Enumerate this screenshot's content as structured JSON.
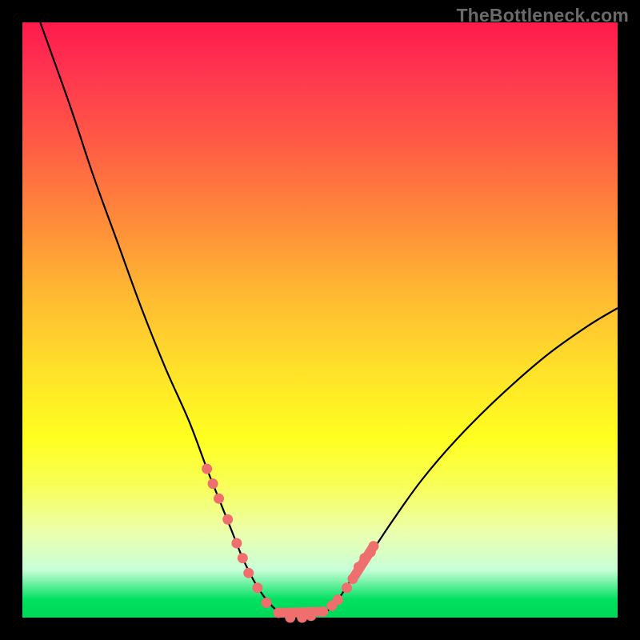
{
  "watermark": "TheBottleneck.com",
  "colors": {
    "frame": "#000000",
    "curve": "#000000",
    "marker": "#ef6f6f",
    "gradient_top": "#ff1a4d",
    "gradient_bottom": "#00d858"
  },
  "chart_data": {
    "type": "line",
    "title": "",
    "xlabel": "",
    "ylabel": "",
    "xlim": [
      0,
      100
    ],
    "ylim": [
      0,
      100
    ],
    "series": [
      {
        "name": "bottleneck-curve",
        "x": [
          3,
          8,
          12,
          16,
          20,
          24,
          28,
          31,
          33,
          35,
          37,
          39,
          41,
          43,
          45,
          48,
          51,
          53,
          55,
          58,
          62,
          67,
          73,
          80,
          88,
          95,
          100
        ],
        "y": [
          100,
          86,
          74,
          63,
          52,
          42,
          33,
          25,
          20,
          15,
          10,
          6,
          3,
          1,
          0,
          0,
          1,
          3,
          6,
          10,
          16,
          23,
          30,
          37,
          44,
          49,
          52
        ]
      }
    ],
    "markers": [
      {
        "x": 31.0,
        "y": 25.0
      },
      {
        "x": 32.0,
        "y": 22.5
      },
      {
        "x": 33.0,
        "y": 20.0
      },
      {
        "x": 34.5,
        "y": 16.5
      },
      {
        "x": 36.0,
        "y": 12.5
      },
      {
        "x": 37.0,
        "y": 10.0
      },
      {
        "x": 38.0,
        "y": 7.5
      },
      {
        "x": 39.5,
        "y": 5.0
      },
      {
        "x": 41.0,
        "y": 2.5
      },
      {
        "x": 43.0,
        "y": 0.8
      },
      {
        "x": 45.0,
        "y": 0.0
      },
      {
        "x": 47.0,
        "y": 0.0
      },
      {
        "x": 48.5,
        "y": 0.3
      },
      {
        "x": 50.5,
        "y": 1.0
      },
      {
        "x": 52.0,
        "y": 2.0
      },
      {
        "x": 53.0,
        "y": 3.0
      },
      {
        "x": 54.5,
        "y": 5.0
      },
      {
        "x": 55.5,
        "y": 6.5
      },
      {
        "x": 56.5,
        "y": 8.5
      },
      {
        "x": 57.5,
        "y": 10.0
      },
      {
        "x": 58.5,
        "y": 11.0
      },
      {
        "x": 59.0,
        "y": 12.0
      }
    ],
    "marker_segments": [
      {
        "x1": 43.0,
        "y1": 0.8,
        "x2": 50.5,
        "y2": 1.0
      },
      {
        "x1": 55.5,
        "y1": 6.5,
        "x2": 59.0,
        "y2": 12.0
      }
    ]
  }
}
